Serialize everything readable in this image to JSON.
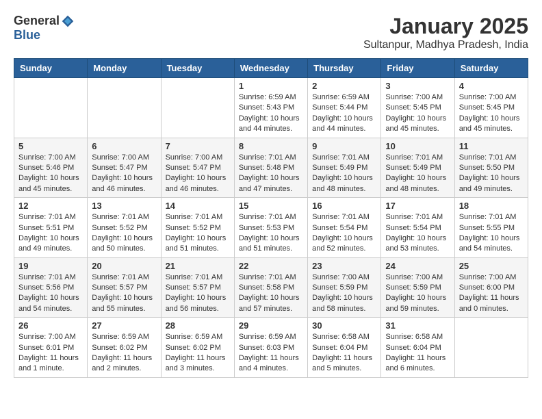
{
  "header": {
    "logo": {
      "general": "General",
      "blue": "Blue"
    },
    "title": "January 2025",
    "subtitle": "Sultanpur, Madhya Pradesh, India"
  },
  "calendar": {
    "headers": [
      "Sunday",
      "Monday",
      "Tuesday",
      "Wednesday",
      "Thursday",
      "Friday",
      "Saturday"
    ],
    "weeks": [
      [
        {
          "day": "",
          "info": ""
        },
        {
          "day": "",
          "info": ""
        },
        {
          "day": "",
          "info": ""
        },
        {
          "day": "1",
          "info": "Sunrise: 6:59 AM\nSunset: 5:43 PM\nDaylight: 10 hours\nand 44 minutes."
        },
        {
          "day": "2",
          "info": "Sunrise: 6:59 AM\nSunset: 5:44 PM\nDaylight: 10 hours\nand 44 minutes."
        },
        {
          "day": "3",
          "info": "Sunrise: 7:00 AM\nSunset: 5:45 PM\nDaylight: 10 hours\nand 45 minutes."
        },
        {
          "day": "4",
          "info": "Sunrise: 7:00 AM\nSunset: 5:45 PM\nDaylight: 10 hours\nand 45 minutes."
        }
      ],
      [
        {
          "day": "5",
          "info": "Sunrise: 7:00 AM\nSunset: 5:46 PM\nDaylight: 10 hours\nand 45 minutes."
        },
        {
          "day": "6",
          "info": "Sunrise: 7:00 AM\nSunset: 5:47 PM\nDaylight: 10 hours\nand 46 minutes."
        },
        {
          "day": "7",
          "info": "Sunrise: 7:00 AM\nSunset: 5:47 PM\nDaylight: 10 hours\nand 46 minutes."
        },
        {
          "day": "8",
          "info": "Sunrise: 7:01 AM\nSunset: 5:48 PM\nDaylight: 10 hours\nand 47 minutes."
        },
        {
          "day": "9",
          "info": "Sunrise: 7:01 AM\nSunset: 5:49 PM\nDaylight: 10 hours\nand 48 minutes."
        },
        {
          "day": "10",
          "info": "Sunrise: 7:01 AM\nSunset: 5:49 PM\nDaylight: 10 hours\nand 48 minutes."
        },
        {
          "day": "11",
          "info": "Sunrise: 7:01 AM\nSunset: 5:50 PM\nDaylight: 10 hours\nand 49 minutes."
        }
      ],
      [
        {
          "day": "12",
          "info": "Sunrise: 7:01 AM\nSunset: 5:51 PM\nDaylight: 10 hours\nand 49 minutes."
        },
        {
          "day": "13",
          "info": "Sunrise: 7:01 AM\nSunset: 5:52 PM\nDaylight: 10 hours\nand 50 minutes."
        },
        {
          "day": "14",
          "info": "Sunrise: 7:01 AM\nSunset: 5:52 PM\nDaylight: 10 hours\nand 51 minutes."
        },
        {
          "day": "15",
          "info": "Sunrise: 7:01 AM\nSunset: 5:53 PM\nDaylight: 10 hours\nand 51 minutes."
        },
        {
          "day": "16",
          "info": "Sunrise: 7:01 AM\nSunset: 5:54 PM\nDaylight: 10 hours\nand 52 minutes."
        },
        {
          "day": "17",
          "info": "Sunrise: 7:01 AM\nSunset: 5:54 PM\nDaylight: 10 hours\nand 53 minutes."
        },
        {
          "day": "18",
          "info": "Sunrise: 7:01 AM\nSunset: 5:55 PM\nDaylight: 10 hours\nand 54 minutes."
        }
      ],
      [
        {
          "day": "19",
          "info": "Sunrise: 7:01 AM\nSunset: 5:56 PM\nDaylight: 10 hours\nand 54 minutes."
        },
        {
          "day": "20",
          "info": "Sunrise: 7:01 AM\nSunset: 5:57 PM\nDaylight: 10 hours\nand 55 minutes."
        },
        {
          "day": "21",
          "info": "Sunrise: 7:01 AM\nSunset: 5:57 PM\nDaylight: 10 hours\nand 56 minutes."
        },
        {
          "day": "22",
          "info": "Sunrise: 7:01 AM\nSunset: 5:58 PM\nDaylight: 10 hours\nand 57 minutes."
        },
        {
          "day": "23",
          "info": "Sunrise: 7:00 AM\nSunset: 5:59 PM\nDaylight: 10 hours\nand 58 minutes."
        },
        {
          "day": "24",
          "info": "Sunrise: 7:00 AM\nSunset: 5:59 PM\nDaylight: 10 hours\nand 59 minutes."
        },
        {
          "day": "25",
          "info": "Sunrise: 7:00 AM\nSunset: 6:00 PM\nDaylight: 11 hours\nand 0 minutes."
        }
      ],
      [
        {
          "day": "26",
          "info": "Sunrise: 7:00 AM\nSunset: 6:01 PM\nDaylight: 11 hours\nand 1 minute."
        },
        {
          "day": "27",
          "info": "Sunrise: 6:59 AM\nSunset: 6:02 PM\nDaylight: 11 hours\nand 2 minutes."
        },
        {
          "day": "28",
          "info": "Sunrise: 6:59 AM\nSunset: 6:02 PM\nDaylight: 11 hours\nand 3 minutes."
        },
        {
          "day": "29",
          "info": "Sunrise: 6:59 AM\nSunset: 6:03 PM\nDaylight: 11 hours\nand 4 minutes."
        },
        {
          "day": "30",
          "info": "Sunrise: 6:58 AM\nSunset: 6:04 PM\nDaylight: 11 hours\nand 5 minutes."
        },
        {
          "day": "31",
          "info": "Sunrise: 6:58 AM\nSunset: 6:04 PM\nDaylight: 11 hours\nand 6 minutes."
        },
        {
          "day": "",
          "info": ""
        }
      ]
    ]
  }
}
